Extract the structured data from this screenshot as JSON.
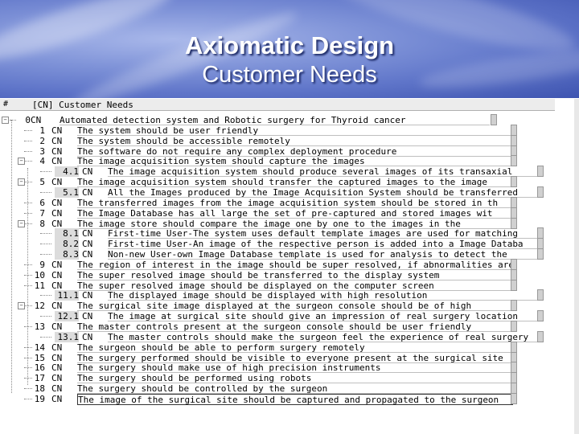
{
  "title": "Axiomatic Design",
  "subtitle": "Customer Needs",
  "header": {
    "hash": "#",
    "label": "[CN] Customer Needs"
  },
  "rows": [
    {
      "num": "0",
      "cn": "CN",
      "text": "Automated detection system and Robotic surgery for Thyroid cancer",
      "level": 0
    },
    {
      "num": "1",
      "cn": "CN",
      "text": "The system should be user friendly",
      "level": 1
    },
    {
      "num": "2",
      "cn": "CN",
      "text": "The system should be accessible remotely",
      "level": 1
    },
    {
      "num": "3",
      "cn": "CN",
      "text": "The software do not require any complex deployment procedure",
      "level": 1
    },
    {
      "num": "4",
      "cn": "CN",
      "text": "The image acquisition system should capture the images",
      "level": 1
    },
    {
      "num": "4.1",
      "cn": "CN",
      "text": "The image acquisition system should produce several images of its transaxial",
      "level": 2
    },
    {
      "num": "5",
      "cn": "CN",
      "text": "The image acquisition system should transfer the captured images to the image",
      "level": 1
    },
    {
      "num": "5.1",
      "cn": "CN",
      "text": "All the Images produced by the Image Acquisition System should be transferred",
      "level": 2
    },
    {
      "num": "6",
      "cn": "CN",
      "text": "The transferred images from the image acquisition system should be stored in th",
      "level": 1
    },
    {
      "num": "7",
      "cn": "CN",
      "text": "The Image Database has all large the set of pre-captured and stored images wit",
      "level": 1
    },
    {
      "num": "8",
      "cn": "CN",
      "text": "The image store should compare the image one by one to the images in the",
      "level": 1
    },
    {
      "num": "8.1",
      "cn": "CN",
      "text": "First-time User-The system  uses default template images are used for matching",
      "level": 2
    },
    {
      "num": "8.2",
      "cn": "CN",
      "text": "First-time User-An image of the respective person is added into a Image Databa",
      "level": 2
    },
    {
      "num": "8.3",
      "cn": "CN",
      "text": "Non-new User-own Image Database template is used for analysis to detect the",
      "level": 2
    },
    {
      "num": "9",
      "cn": "CN",
      "text": "The region of interest in the image should be super resolved, if abnormalities are",
      "level": 1
    },
    {
      "num": "10",
      "cn": "CN",
      "text": "The super resolved image should be transferred to the display system",
      "level": 1
    },
    {
      "num": "11",
      "cn": "CN",
      "text": "The super resolved image should be displayed on the computer screen",
      "level": 1
    },
    {
      "num": "11.1",
      "cn": "CN",
      "text": "The displayed image should be displayed with high resolution",
      "level": 2
    },
    {
      "num": "12",
      "cn": "CN",
      "text": "The surgical site image displayed at the surgeon console should be of high",
      "level": 1
    },
    {
      "num": "12.1",
      "cn": "CN",
      "text": "The image at surgical site should give an impression of real surgery location",
      "level": 2
    },
    {
      "num": "13",
      "cn": "CN",
      "text": "The master controls present at the surgeon console should be user friendly",
      "level": 1
    },
    {
      "num": "13.1",
      "cn": "CN",
      "text": "The master controls should make the surgeon feel the experience of real surgery",
      "level": 2
    },
    {
      "num": "14",
      "cn": "CN",
      "text": "The surgeon should be able to perform surgery remotely",
      "level": 1
    },
    {
      "num": "15",
      "cn": "CN",
      "text": "The surgery performed should be visible to everyone present at the surgical site",
      "level": 1
    },
    {
      "num": "16",
      "cn": "CN",
      "text": "The surgery should make use of high precision instruments",
      "level": 1
    },
    {
      "num": "17",
      "cn": "CN",
      "text": "The surgery should be performed using robots",
      "level": 1
    },
    {
      "num": "18",
      "cn": "CN",
      "text": "The surgery should be controlled by the surgeon",
      "level": 1
    },
    {
      "num": "19",
      "cn": "CN",
      "text": "The image of the surgical site should be captured and propagated to the surgeon",
      "level": 1
    }
  ]
}
